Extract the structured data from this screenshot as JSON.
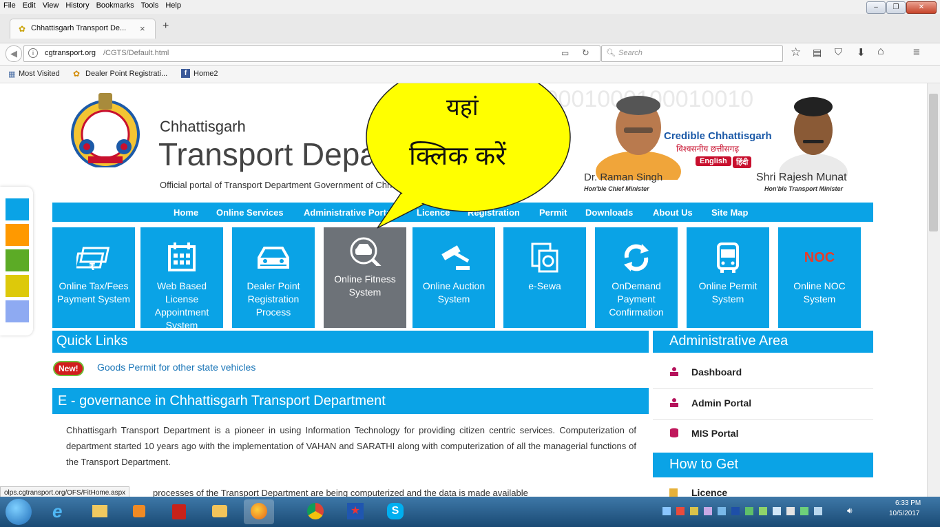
{
  "menu": [
    "File",
    "Edit",
    "View",
    "History",
    "Bookmarks",
    "Tools",
    "Help"
  ],
  "tab": {
    "title": "Chhattisgarh Transport De...",
    "close": "×",
    "new_tab": "+"
  },
  "url": {
    "domain": "cgtransport.org",
    "path": "/CGTS/Default.html"
  },
  "search": {
    "placeholder": "Search"
  },
  "bookmarks": [
    "Most Visited",
    "Dealer Point Registrati...",
    "Home2"
  ],
  "site": {
    "state": "Chhattisgarh",
    "department": "Transport Department",
    "tagline": "Official portal of Transport Department Government of Chhattisgarh",
    "watermark_digits": "10010001000100010010",
    "cm_name": "Dr. Raman Singh",
    "cm_title": "Hon'ble Chief Minister",
    "minister_name": "Shri Rajesh Munat",
    "minister_title": "Hon'ble Transport Minister",
    "brand": "Credible Chhattisgarh",
    "brand_hindi": "विश्वसनीय छत्तीसगढ़",
    "lang_english": "English",
    "lang_hindi": "हिंदी"
  },
  "nav": [
    "Home",
    "Online Services",
    "Administrative Portal",
    "Licence",
    "Registration",
    "Permit",
    "Downloads",
    "About Us",
    "Site Map"
  ],
  "tiles": [
    {
      "label": "Online Tax/Fees Payment System",
      "icon": "money-icon"
    },
    {
      "label": "Web Based License Appointment System",
      "icon": "calendar-icon"
    },
    {
      "label": "Dealer Point Registration Process",
      "icon": "car-icon"
    },
    {
      "label": "Online Fitness System",
      "icon": "car-search-icon"
    },
    {
      "label": "Online Auction System",
      "icon": "gavel-icon"
    },
    {
      "label": "e-Sewa",
      "icon": "document-icon"
    },
    {
      "label": "OnDemand Payment Confirmation",
      "icon": "refresh-icon"
    },
    {
      "label": "Online Permit System",
      "icon": "bus-icon"
    },
    {
      "label": "Online NOC System",
      "icon": "noc-icon"
    }
  ],
  "callout": {
    "line1": "यहां",
    "line2": "क्लिक करें"
  },
  "quick_links": {
    "title": "Quick Links",
    "new_badge": "New!",
    "item": "Goods Permit for other state vehicles"
  },
  "egov": {
    "title": "E - governance in Chhattisgarh Transport Department",
    "para1": "Chhattisgarh Transport Department is a pioneer in using Information Technology for providing citizen centric services. Computerization of department started 10 years ago with the implementation of VAHAN and SARATHI along with computerization of all the managerial functions of the Transport Department.",
    "para2": "processes of the Transport Department are being computerized and the data is made available"
  },
  "admin": {
    "title": "Administrative Area",
    "items": [
      "Dashboard",
      "Admin Portal",
      "MIS Portal"
    ]
  },
  "how_to_get": {
    "title": "How to Get",
    "items": [
      "Licence"
    ]
  },
  "status_url": "olps.cgtransport.org/OFS/FitHome.aspx",
  "clock": {
    "time": "6:33 PM",
    "date": "10/5/2017"
  },
  "colors": {
    "brand_blue": "#0aa3e6",
    "selected_tile": "#6d7278",
    "callout_yellow": "#ffff00",
    "red_badge": "#c8102e"
  }
}
